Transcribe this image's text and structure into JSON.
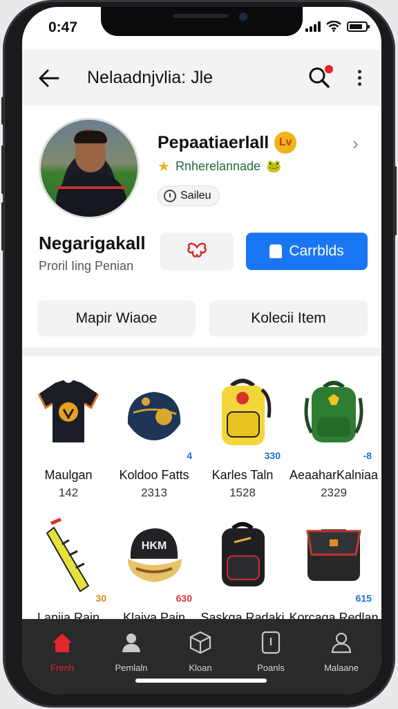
{
  "status_bar": {
    "time": "0:47"
  },
  "app_bar": {
    "title": "Nelaadnjvlia: Jle"
  },
  "profile": {
    "name": "Pepaatiaerlall",
    "name_badge": "Lv",
    "subtitle": "Rnherelannade",
    "subtitle_icon": "🐸",
    "status_label": "Saileu",
    "username": "Negarigakall",
    "user_description": "Proril Iing Penian",
    "primary_button_label": "Carrblds"
  },
  "tabs": [
    {
      "label": "Mapir Wiaoe"
    },
    {
      "label": "Kolecii Item"
    }
  ],
  "items": [
    {
      "name": "Maulgan",
      "count": "142",
      "tag": "",
      "kind": "jersey"
    },
    {
      "name": "Koldoo Fatts",
      "count": "2313",
      "tag": "4",
      "kind": "helmet"
    },
    {
      "name": "Karles Taln",
      "count": "1528",
      "tag": "330",
      "kind": "backpack-yellow"
    },
    {
      "name": "AeaaharKalniaa",
      "count": "2329",
      "tag": "-8",
      "kind": "backpack-green"
    },
    {
      "name": "Laniia Rain",
      "count": "",
      "tag": "30",
      "kind": "scarf"
    },
    {
      "name": "Klaiya Pain",
      "count": "",
      "tag": "630",
      "kind": "cap"
    },
    {
      "name": "Saskga Radaki",
      "count": "",
      "tag": "",
      "kind": "backpack-black"
    },
    {
      "name": "Korcaga Redlan",
      "count": "",
      "tag": "615",
      "kind": "bag-black"
    }
  ],
  "bottom_nav": [
    {
      "label": "Frenh",
      "icon": "home-icon",
      "active": true
    },
    {
      "label": "Pemlaln",
      "icon": "person-icon",
      "active": false
    },
    {
      "label": "Kloan",
      "icon": "box-icon",
      "active": false
    },
    {
      "label": "Poanls",
      "icon": "phone-card-icon",
      "active": false
    },
    {
      "label": "Malaane",
      "icon": "user-outline-icon",
      "active": false
    }
  ],
  "colors": {
    "accent": "#1876f2",
    "active_nav": "#e3262d",
    "nav_bg": "#2a2a2c"
  }
}
